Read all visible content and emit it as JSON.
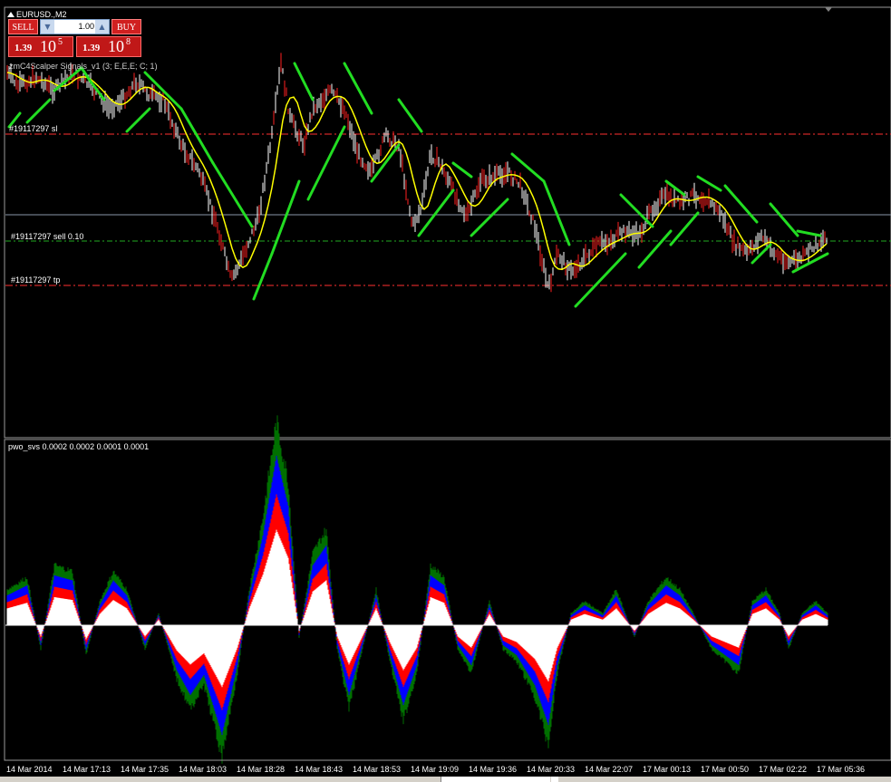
{
  "chart": {
    "symbol_title": "EURUSD.,M2",
    "indicator_label": "zmC4Scalper Signals_v1 (3; E,E,E; C; 1)",
    "order_labels": {
      "sl": "#19117297 sl",
      "sell": "#19117297 sell 0.10",
      "tp": "#19117297 tp"
    }
  },
  "trade_panel": {
    "sell_label": "SELL",
    "buy_label": "BUY",
    "lot": "1.00",
    "sell_price": {
      "prefix": "1.39",
      "big": "10",
      "sup": "5"
    },
    "buy_price": {
      "prefix": "1.39",
      "big": "10",
      "sup": "8"
    }
  },
  "oscillator": {
    "label": "pwo_svs 0.0002 0.0002 0.0001 0.0001"
  },
  "time_axis": [
    "14 Mar 2014",
    "14 Mar 17:13",
    "14 Mar 17:35",
    "14 Mar 18:03",
    "14 Mar 18:28",
    "14 Mar 18:43",
    "14 Mar 18:53",
    "14 Mar 19:09",
    "14 Mar 19:36",
    "14 Mar 20:33",
    "14 Mar 22:07",
    "17 Mar 00:13",
    "17 Mar 00:50",
    "17 Mar 02:22",
    "17 Mar 05:36"
  ],
  "colors": {
    "background": "#000000",
    "price_bars": "#ffffff",
    "bull_bars": "#ff2020",
    "moving_average": "#ffff00",
    "signal_lines": "#22dd22",
    "sl_tp_lines": "#ff3030",
    "sell_line": "#22aa22",
    "osc_white": "#ffffff",
    "osc_red": "#ff0000",
    "osc_blue": "#0000ff",
    "osc_green": "#007000"
  }
}
